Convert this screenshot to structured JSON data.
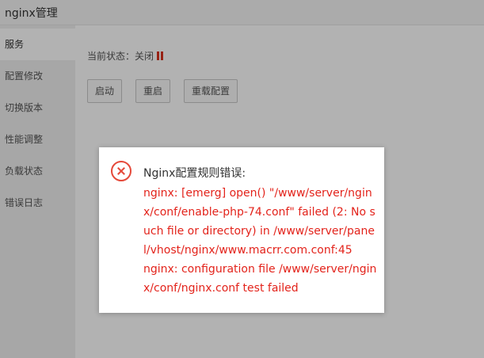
{
  "app": {
    "title": "nginx管理"
  },
  "sidebar": {
    "items": [
      {
        "label": "服务"
      },
      {
        "label": "配置修改"
      },
      {
        "label": "切换版本"
      },
      {
        "label": "性能调整"
      },
      {
        "label": "负载状态"
      },
      {
        "label": "错误日志"
      }
    ]
  },
  "main": {
    "status_label": "当前状态：关闭",
    "status_color": "#d9321e",
    "buttons": [
      {
        "label": "启动"
      },
      {
        "label": "重启"
      },
      {
        "label": "重载配置"
      }
    ]
  },
  "dialog": {
    "icon": "error-circle-icon",
    "title": "Nginx配置规则错误:",
    "message_color": "#e3231b",
    "message_lines": [
      "nginx: [emerg] open() \"/www/server/ngin",
      "x/conf/enable-php-74.conf\" failed (2: No s",
      "uch file or directory) in /www/server/pane",
      "l/vhost/nginx/www.macrr.com.conf:45",
      "nginx: configuration file /www/server/ngin",
      "x/conf/nginx.conf test failed"
    ]
  }
}
